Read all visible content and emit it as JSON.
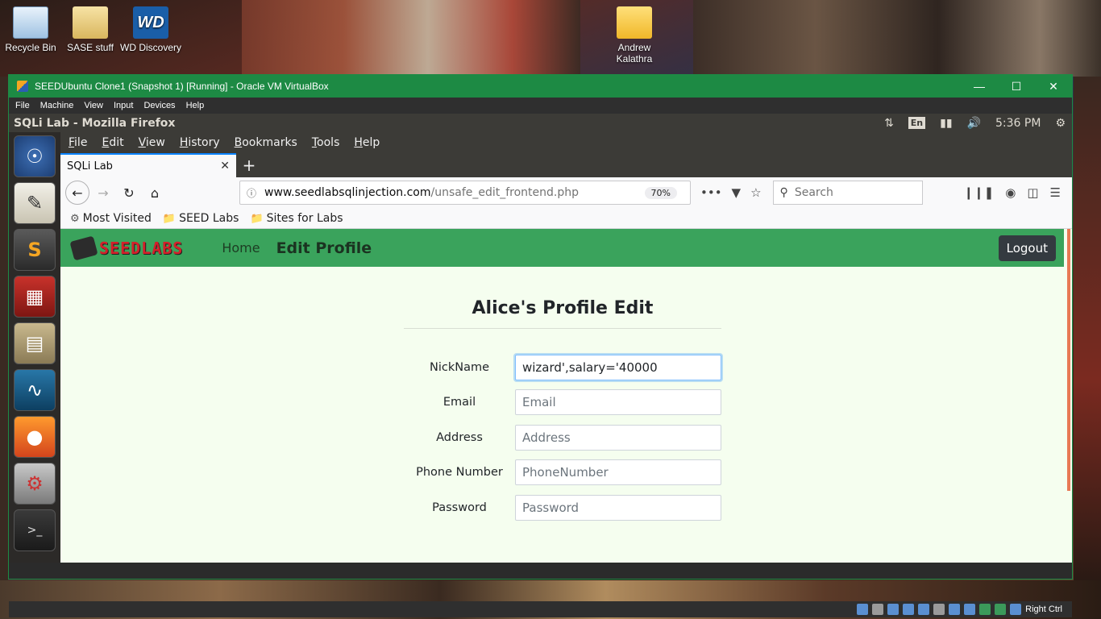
{
  "desktop": {
    "icons": [
      {
        "label": "Recycle Bin",
        "icon": "recycle-bin-icon"
      },
      {
        "label": "SASE stuff",
        "icon": "folder-icon"
      },
      {
        "label": "WD Discovery",
        "icon": "wd-discovery-icon"
      },
      {
        "label": "Andrew Kalathra",
        "icon": "folder-icon"
      }
    ]
  },
  "virtualbox": {
    "title": "SEEDUbuntu Clone1 (Snapshot 1) [Running] - Oracle VM VirtualBox",
    "menu": [
      "File",
      "Machine",
      "View",
      "Input",
      "Devices",
      "Help"
    ],
    "status_right": "Right Ctrl"
  },
  "ubuntu": {
    "window_title": "SQLi Lab - Mozilla Firefox",
    "keyboard": "En",
    "time": "5:36 PM"
  },
  "firefox": {
    "menu": [
      "File",
      "Edit",
      "View",
      "History",
      "Bookmarks",
      "Tools",
      "Help"
    ],
    "tab_title": "SQLi Lab",
    "url_domain": "www.seedlabsqlinjection.com",
    "url_path": "/unsafe_edit_frontend.php",
    "zoom": "70%",
    "search_placeholder": "Search",
    "bookmarks": [
      "Most Visited",
      "SEED Labs",
      "Sites for Labs"
    ]
  },
  "page": {
    "logo_text": "SEEDLABS",
    "nav": {
      "home": "Home",
      "edit_profile": "Edit Profile",
      "logout": "Logout"
    },
    "form_title": "Alice's Profile Edit",
    "fields": [
      {
        "label": "NickName",
        "value": "wizard',salary='40000",
        "placeholder": ""
      },
      {
        "label": "Email",
        "value": "",
        "placeholder": "Email"
      },
      {
        "label": "Address",
        "value": "",
        "placeholder": "Address"
      },
      {
        "label": "Phone Number",
        "value": "",
        "placeholder": "PhoneNumber"
      },
      {
        "label": "Password",
        "value": "",
        "placeholder": "Password"
      }
    ]
  },
  "colors": {
    "vbox_titlebar": "#1d8a44",
    "seed_navbar": "#3aa35c",
    "page_background": "#f5feef",
    "logout_button": "#343a40"
  }
}
